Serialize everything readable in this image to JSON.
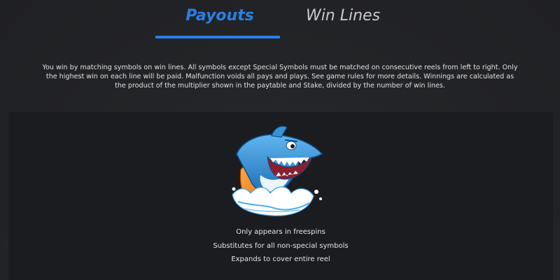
{
  "tabs": [
    {
      "label": "Payouts",
      "active": true
    },
    {
      "label": "Win Lines",
      "active": false
    }
  ],
  "colors": {
    "accent": "#2a7fe6",
    "background": "#222326",
    "panel": "#1b1c1f"
  },
  "description": "You win by matching symbols on win lines. All symbols except Special Symbols must be matched on consecutive reels from left to right. Only the highest win on each line will be paid. Malfunction voids all pays and plays. See game rules for more details. Winnings are calculated as the product of the multiplier shown in the paytable and Stake, divided by the number of win lines.",
  "symbol": {
    "icon": "shark-surfer-icon",
    "features": [
      "Only appears in freespins",
      "Substitutes for all non-special symbols",
      "Expands to cover entire reel"
    ]
  }
}
